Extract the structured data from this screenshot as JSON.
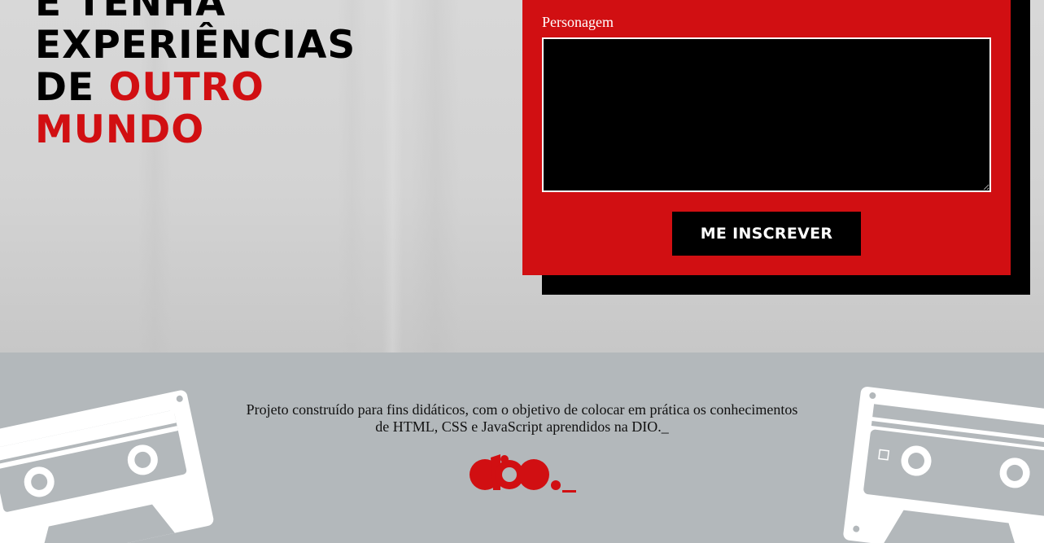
{
  "hero": {
    "heading_line1": "E TENHA",
    "heading_line2": "EXPERIÊNCIAS",
    "heading_line3_black": "DE ",
    "heading_line3_red": "OUTRO",
    "heading_line4_red": "MUNDO"
  },
  "form": {
    "label": "Personagem",
    "textarea_value": "",
    "submit_label": "ME INSCREVER"
  },
  "footer": {
    "text": "Projeto construído para fins didáticos, com o objetivo de colocar em prática os conhecimentos de HTML, CSS e JavaScript aprendidos na DIO._"
  },
  "colors": {
    "accent": "#d10f12",
    "hero_bg": "#d3d3d3",
    "footer_bg": "#b3b8bb"
  },
  "icons": {
    "left": "cassette-tape-icon",
    "right": "cassette-tape-icon",
    "logo": "dio-logo"
  }
}
